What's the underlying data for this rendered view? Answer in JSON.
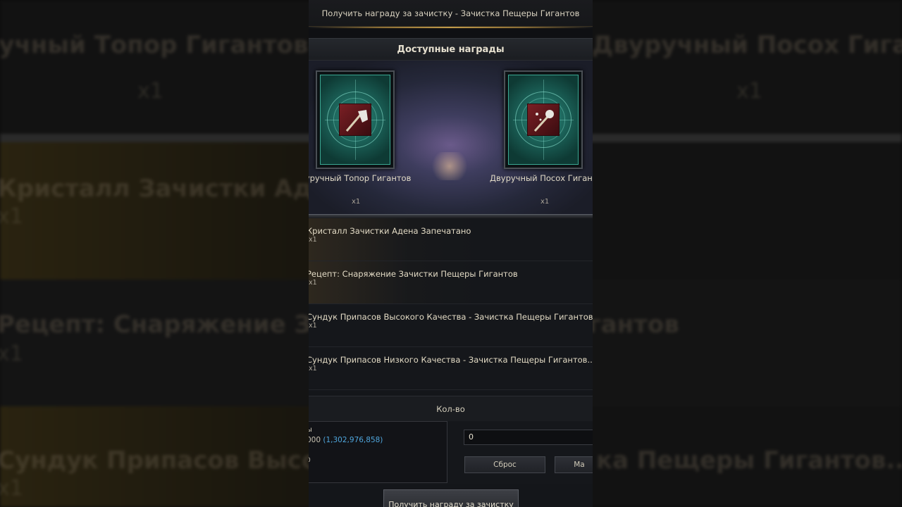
{
  "window": {
    "title": "Получить награду за зачистку - Зачистка Пещеры Гигантов"
  },
  "available": {
    "title": "Доступные награды",
    "items": [
      {
        "label": "Двуручный Топор Гигантов",
        "qty": "x1",
        "icon": "axe-icon"
      },
      {
        "label": "Двуручный Посох Гигантов",
        "qty": "x1",
        "icon": "staff-icon"
      }
    ]
  },
  "rewards": [
    {
      "name": "Кристалл Зачистки Адена Запечатано",
      "qty": "x1"
    },
    {
      "name": "Рецепт: Снаряжение Зачистки Пещеры Гигантов",
      "qty": "x1"
    },
    {
      "name": "Сундук Припасов Высокого Качества - Зачистка Пещеры Гигантов...",
      "qty": "x1"
    },
    {
      "name": "Сундук Припасов Низкого Качества - Зачистка Пещеры Гигантов...",
      "qty": "x1"
    }
  ],
  "quantity": {
    "header": "Кол-во",
    "left_label": "ы",
    "cost_prefix": "000",
    "balance": "(1,302,976,858)",
    "small_label": "0",
    "value": "0",
    "reset_label": "Сброс",
    "max_label": "Ма"
  },
  "claim_button": "Получить награду за зачистку",
  "background": {
    "top_left": "Двуручный Топор Гигантов",
    "top_right": "Двуручный Посох Гигантов",
    "qty": "x1",
    "row1": "Кристалл Зачистки Адена",
    "row2": "Рецепт: Снаряжение Зачистки Пещеры Гигантов",
    "row3_left": "Сундук Припасов Высокого Качества",
    "row3_right": "ка Пещеры Гигантов..."
  },
  "colors": {
    "accent_gold": "#c09a4a",
    "balance_blue": "#4fa6dd",
    "teal_card": "#1a5e55"
  }
}
